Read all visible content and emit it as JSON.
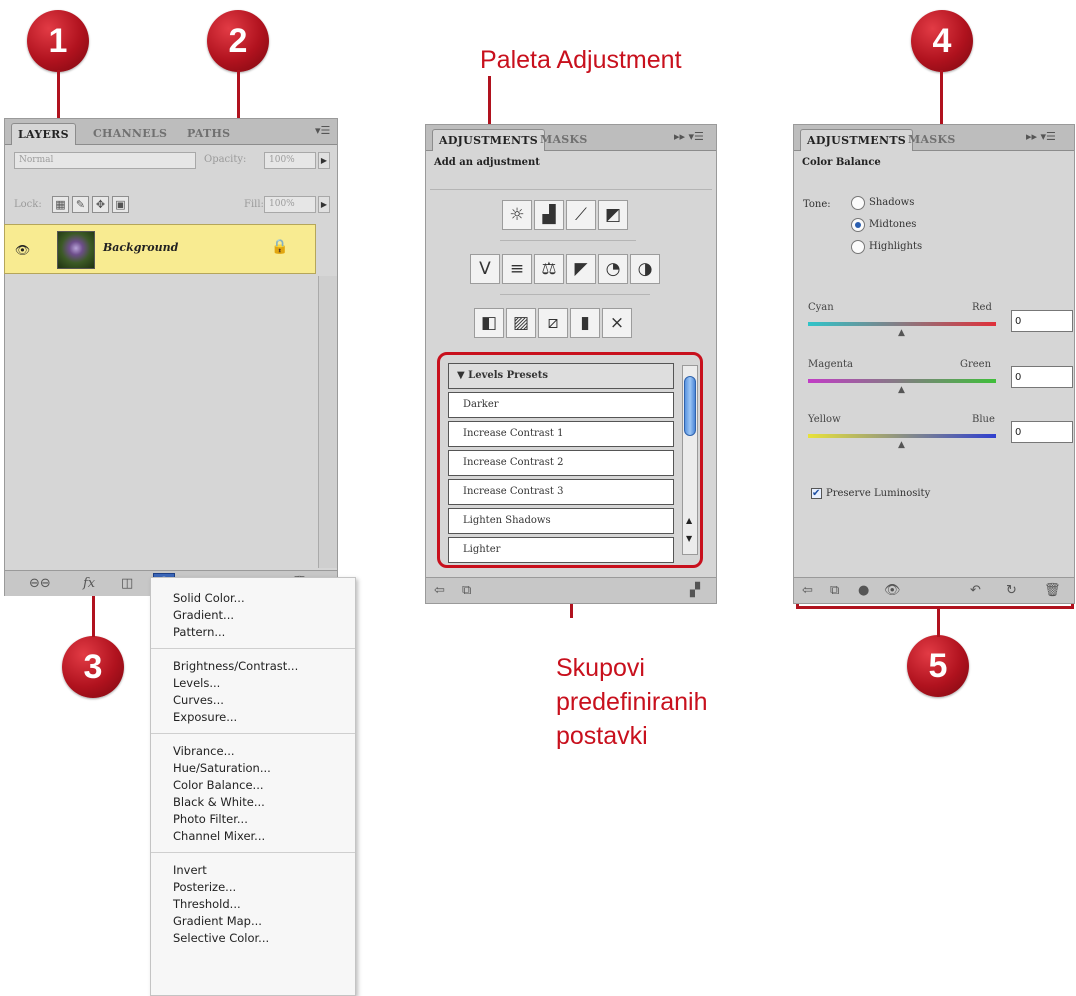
{
  "callouts": [
    "1",
    "2",
    "3",
    "4",
    "5"
  ],
  "captions": {
    "adjustment_palette": "Paleta Adjustment",
    "presets_line1": "Skupovi",
    "presets_line2": "predefiniranih",
    "presets_line3": "postavki"
  },
  "accent_color": "#c8101d",
  "layers_panel": {
    "tabs": [
      "LAYERS",
      "CHANNELS",
      "PATHS"
    ],
    "menu_icon": "panel-menu-icon",
    "blend_mode": "Normal",
    "opacity_label": "Opacity:",
    "opacity_value": "100%",
    "lock_label": "Lock:",
    "fill_label": "Fill:",
    "fill_value": "100%",
    "layer": {
      "name": "Background",
      "visible_icon": "eye-icon",
      "lock_icon": "lock-icon"
    },
    "bottom_icons": [
      "link-icon",
      "fx-icon",
      "mask-icon",
      "adjustment-layer-icon",
      "group-icon",
      "new-layer-icon",
      "trash-icon"
    ],
    "fx_label": "fx"
  },
  "adjustment_menu": {
    "group1": [
      "Solid Color...",
      "Gradient...",
      "Pattern..."
    ],
    "group2": [
      "Brightness/Contrast...",
      "Levels...",
      "Curves...",
      "Exposure..."
    ],
    "group3": [
      "Vibrance...",
      "Hue/Saturation...",
      "Color Balance...",
      "Black & White...",
      "Photo Filter...",
      "Channel Mixer..."
    ],
    "group4": [
      "Invert",
      "Posterize...",
      "Threshold...",
      "Gradient Map...",
      "Selective Color..."
    ]
  },
  "adjustments_panel": {
    "tabs": [
      "ADJUSTMENTS",
      "MASKS"
    ],
    "title": "Add an adjustment",
    "icon_row1": [
      "brightness-contrast-icon",
      "levels-icon",
      "curves-icon",
      "exposure-icon"
    ],
    "icon_row2": [
      "vibrance-icon",
      "hue-saturation-icon",
      "color-balance-icon",
      "black-white-icon",
      "photo-filter-icon",
      "channel-mixer-icon"
    ],
    "icon_row3": [
      "invert-icon",
      "posterize-icon",
      "threshold-icon",
      "gradient-map-icon",
      "selective-color-icon"
    ],
    "presets": [
      "Levels Presets",
      "Darker",
      "Increase Contrast 1",
      "Increase Contrast 2",
      "Increase Contrast 3",
      "Lighten Shadows",
      "Lighter"
    ]
  },
  "color_balance_panel": {
    "tabs": [
      "ADJUSTMENTS",
      "MASKS"
    ],
    "title": "Color Balance",
    "tone_label": "Tone:",
    "tones": [
      "Shadows",
      "Midtones",
      "Highlights"
    ],
    "selected_tone": "Midtones",
    "sliders": [
      {
        "left": "Cyan",
        "right": "Red",
        "value": "0"
      },
      {
        "left": "Magenta",
        "right": "Green",
        "value": "0"
      },
      {
        "left": "Yellow",
        "right": "Blue",
        "value": "0"
      }
    ],
    "preserve_luminosity": "Preserve Luminosity",
    "preserve_checked": true
  }
}
